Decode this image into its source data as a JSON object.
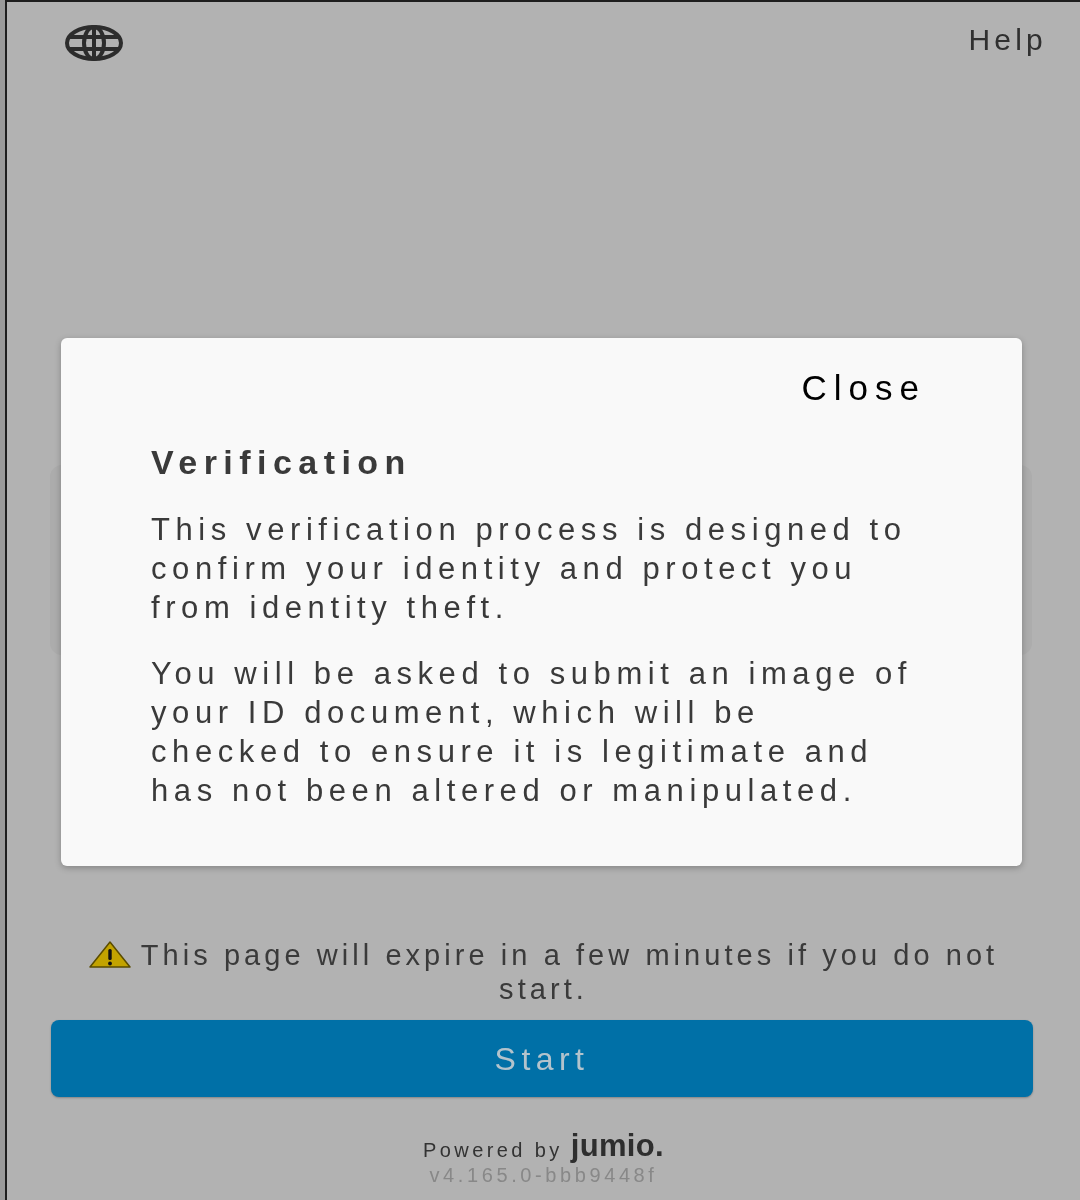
{
  "header": {
    "help_link": "Help"
  },
  "dialog": {
    "close_button": "Close",
    "title": "Verification",
    "paragraphs": [
      "This verification process is designed to confirm your identity and protect you from identity theft.",
      "You will be asked to submit an image of your ID document, which will be checked to ensure it is legitimate and has not been altered or manipulated."
    ]
  },
  "expiry_warning": "This page will expire in a few minutes if you do not start.",
  "start_button": "Start",
  "footer": {
    "powered_by": "Powered by",
    "brand": "jumio.",
    "version": "v4.165.0-bbb9448f"
  }
}
